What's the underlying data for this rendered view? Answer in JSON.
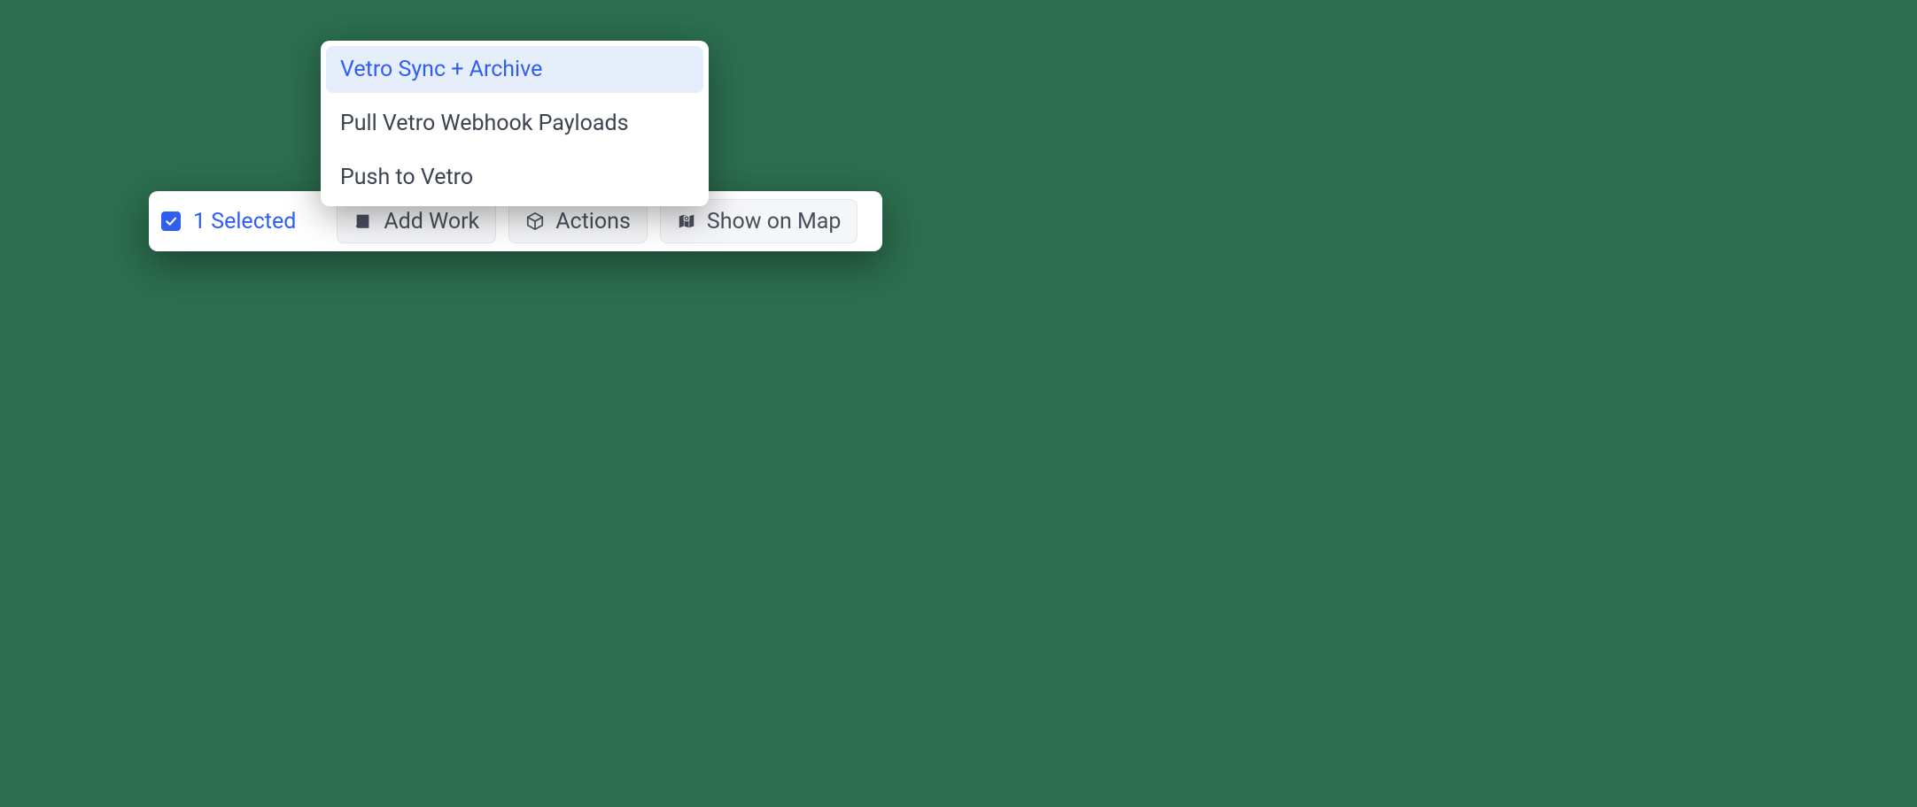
{
  "dropdown": {
    "items": [
      {
        "label": "Vetro Sync + Archive",
        "highlighted": true
      },
      {
        "label": "Pull Vetro Webhook Payloads",
        "highlighted": false
      },
      {
        "label": "Push to Vetro",
        "highlighted": false
      }
    ]
  },
  "toolbar": {
    "selected_label": "1 Selected",
    "add_work_label": "Add Work",
    "actions_label": "Actions",
    "show_on_map_label": "Show on Map"
  },
  "colors": {
    "accent": "#2f5ef3",
    "background": "#2c6e4f",
    "panel": "#ffffff",
    "button_bg": "#f5f6f8",
    "text": "#474f5c"
  }
}
